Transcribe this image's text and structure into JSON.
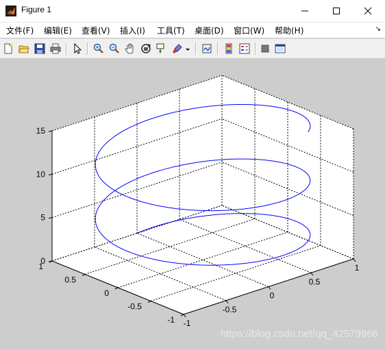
{
  "window": {
    "title": "Figure 1"
  },
  "menu": {
    "items": [
      {
        "label": "文件(F)"
      },
      {
        "label": "编辑(E)"
      },
      {
        "label": "查看(V)"
      },
      {
        "label": "插入(I)"
      },
      {
        "label": "工具(T)"
      },
      {
        "label": "桌面(D)"
      },
      {
        "label": "窗口(W)"
      },
      {
        "label": "帮助(H)"
      }
    ]
  },
  "toolbar": {
    "icons": [
      "new-figure-icon",
      "open-file-icon",
      "save-icon",
      "print-icon",
      "pointer-icon",
      "zoom-in-icon",
      "zoom-out-icon",
      "pan-hand-icon",
      "rotate-3d-icon",
      "data-cursor-icon",
      "brush-icon",
      "brush-dropdown-icon",
      "link-plot-icon",
      "colorbar-icon",
      "legend-icon",
      "hide-plot-tools-icon",
      "show-plot-tools-icon"
    ]
  },
  "chart_data": {
    "type": "line",
    "projection": "3d",
    "series": [
      {
        "color": "#0000ff",
        "x": "sin(t)",
        "y": "cos(t)",
        "z": "t",
        "t_range": [
          0,
          15
        ]
      }
    ],
    "xlim": [
      -1,
      1
    ],
    "ylim": [
      -1,
      1
    ],
    "zlim": [
      0,
      15
    ],
    "xticks": [
      "-1",
      "-0.5",
      "0",
      "0.5",
      "1"
    ],
    "yticks": [
      "1",
      "0.5",
      "0",
      "-0.5",
      "-1"
    ],
    "zticks": [
      "0",
      "5",
      "10",
      "15"
    ],
    "grid": true
  },
  "watermark": "https://blog.csdn.net/qq_42579966"
}
